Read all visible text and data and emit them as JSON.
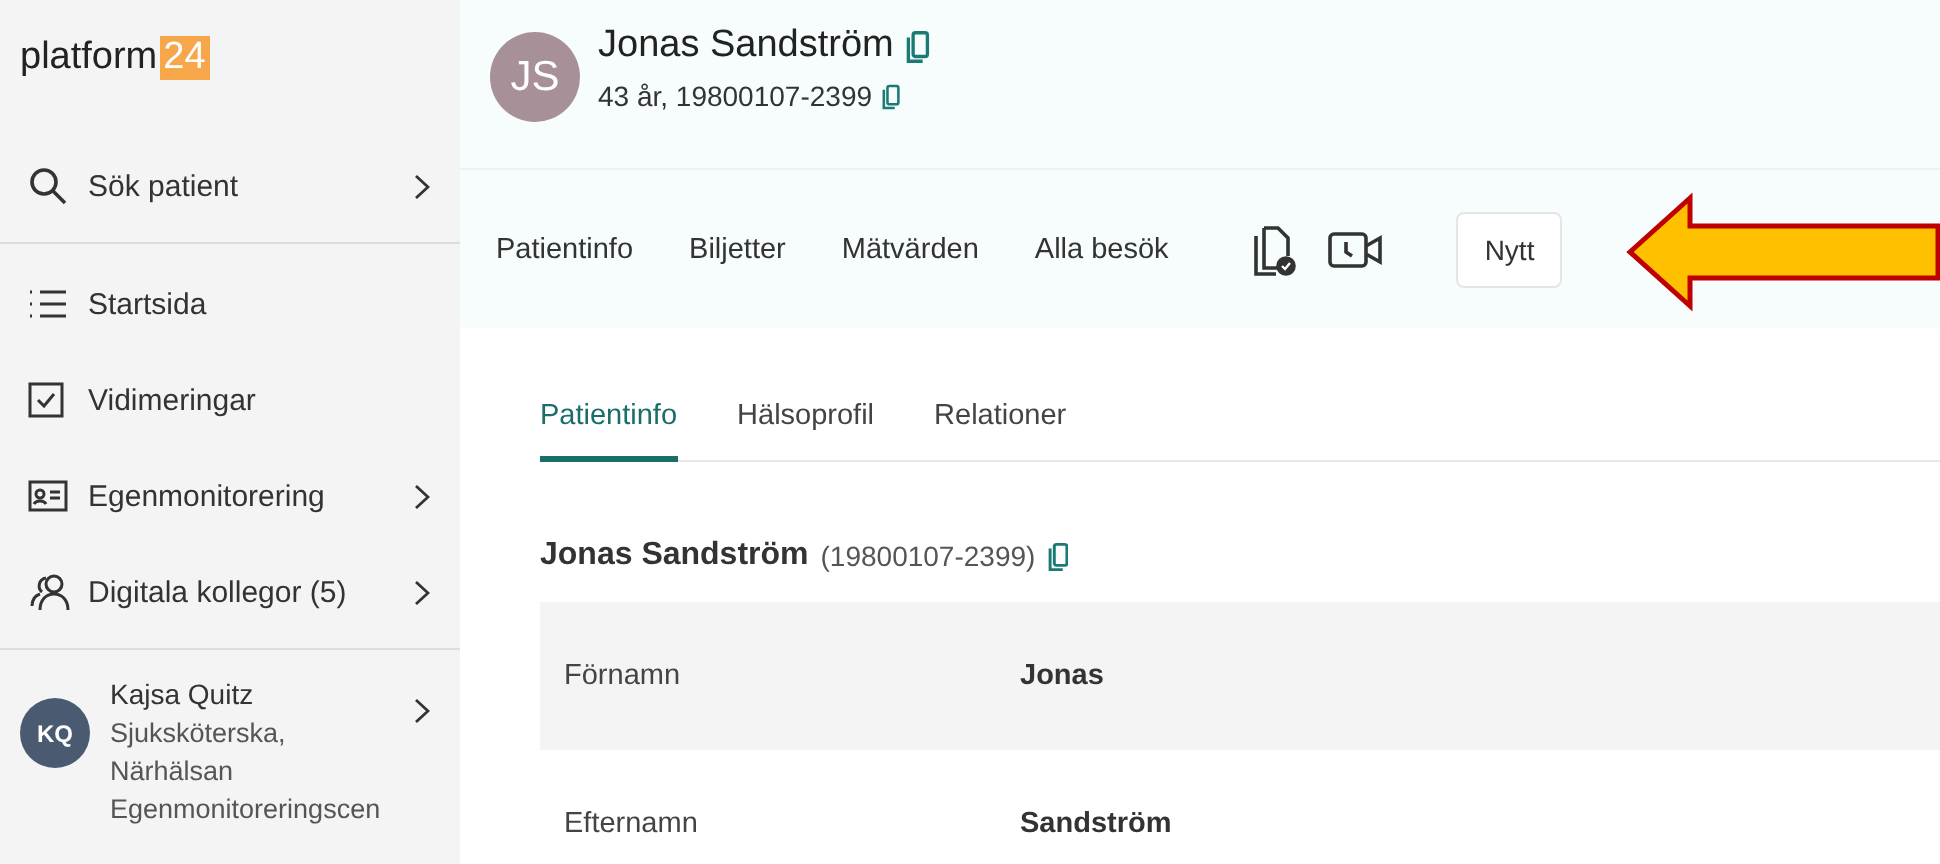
{
  "logo": {
    "text": "platform",
    "badge": "24"
  },
  "sidebar": {
    "search": {
      "label": "Sök patient",
      "kind": "search",
      "chevron": true
    },
    "items": [
      {
        "label": "Startsida",
        "kind": "list",
        "chevron": false
      },
      {
        "label": "Vidimeringar",
        "kind": "checkbox",
        "chevron": false
      },
      {
        "label": "Egenmonitorering",
        "kind": "card",
        "chevron": true
      },
      {
        "label": "Digitala kollegor (5)",
        "kind": "people",
        "chevron": true
      }
    ],
    "user": {
      "initials": "KQ",
      "name": "Kajsa Quitz",
      "role": "Sjuksköterska,",
      "unit": "Närhälsan",
      "unit_2": "Egenmonitoreringscen",
      "chevron": true
    }
  },
  "patient": {
    "initials": "JS",
    "name": "Jonas Sandström",
    "details": "43 år, 19800107-2399"
  },
  "nav": {
    "items": [
      {
        "label": "Patientinfo"
      },
      {
        "label": "Biljetter"
      },
      {
        "label": "Mätvärden"
      },
      {
        "label": "Alla besök"
      }
    ],
    "button": "Nytt"
  },
  "tabs": [
    {
      "label": "Patientinfo",
      "selected": true
    },
    {
      "label": "Hälsoprofil",
      "selected": false
    },
    {
      "label": "Relationer",
      "selected": false
    }
  ],
  "heading": {
    "name": "Jonas Sandström",
    "id": "(19800107-2399)"
  },
  "fields": [
    {
      "label": "Förnamn",
      "value": "Jonas"
    },
    {
      "label": "Efternamn",
      "value": "Sandström"
    }
  ]
}
